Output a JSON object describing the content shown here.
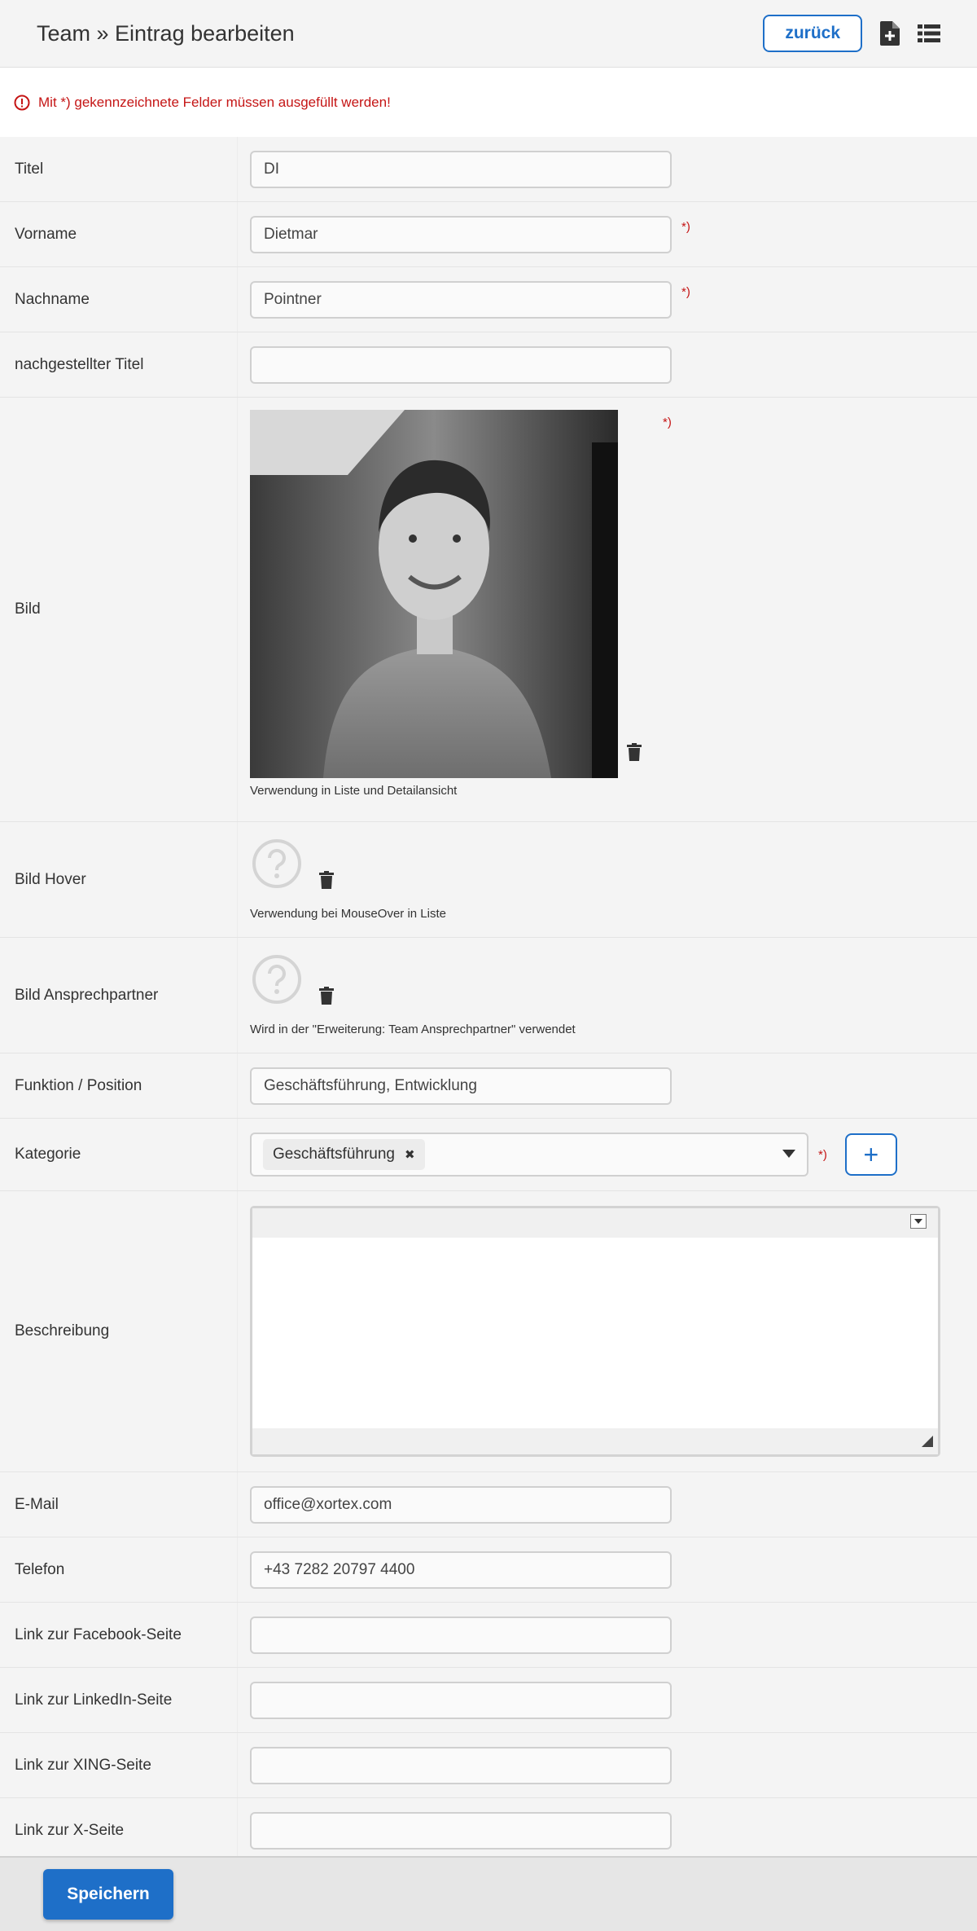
{
  "header": {
    "title": "Team » Eintrag bearbeiten",
    "back_label": "zurück",
    "icons": [
      "new-document-icon",
      "list-icon"
    ]
  },
  "notice": {
    "text": "Mit *) gekennzeichnete Felder müssen ausgefüllt werden!"
  },
  "required_marker": "*)",
  "fields": {
    "titel": {
      "label": "Titel",
      "value": "DI"
    },
    "vorname": {
      "label": "Vorname",
      "value": "Dietmar"
    },
    "nachname": {
      "label": "Nachname",
      "value": "Pointner"
    },
    "nachgestellter_titel": {
      "label": "nachgestellter Titel",
      "value": ""
    },
    "bild": {
      "label": "Bild",
      "hint": "Verwendung in Liste und Detailansicht"
    },
    "bild_hover": {
      "label": "Bild Hover",
      "hint": "Verwendung bei MouseOver in Liste"
    },
    "bild_ansprechpartner": {
      "label": "Bild Ansprechpartner",
      "hint": "Wird in der \"Erweiterung: Team Ansprechpartner\" verwendet"
    },
    "funktion": {
      "label": "Funktion / Position",
      "value": "Geschäftsführung, Entwicklung"
    },
    "kategorie": {
      "label": "Kategorie",
      "tags": [
        "Geschäftsführung"
      ],
      "remove_glyph": "✖",
      "add_label": "+"
    },
    "beschreibung": {
      "label": "Beschreibung",
      "value": ""
    },
    "email": {
      "label": "E-Mail",
      "value": "office@xortex.com"
    },
    "telefon": {
      "label": "Telefon",
      "value": "+43 7282 20797 4400"
    },
    "facebook": {
      "label": "Link zur Facebook-Seite",
      "value": ""
    },
    "linkedin": {
      "label": "Link zur LinkedIn-Seite",
      "value": ""
    },
    "xing": {
      "label": "Link zur XING-Seite",
      "value": ""
    },
    "x": {
      "label": "Link zur X-Seite",
      "value": ""
    }
  },
  "footer": {
    "save_label": "Speichern"
  },
  "colors": {
    "accent": "#1e6fc8",
    "required": "#c51515",
    "background": "#f4f4f4"
  }
}
